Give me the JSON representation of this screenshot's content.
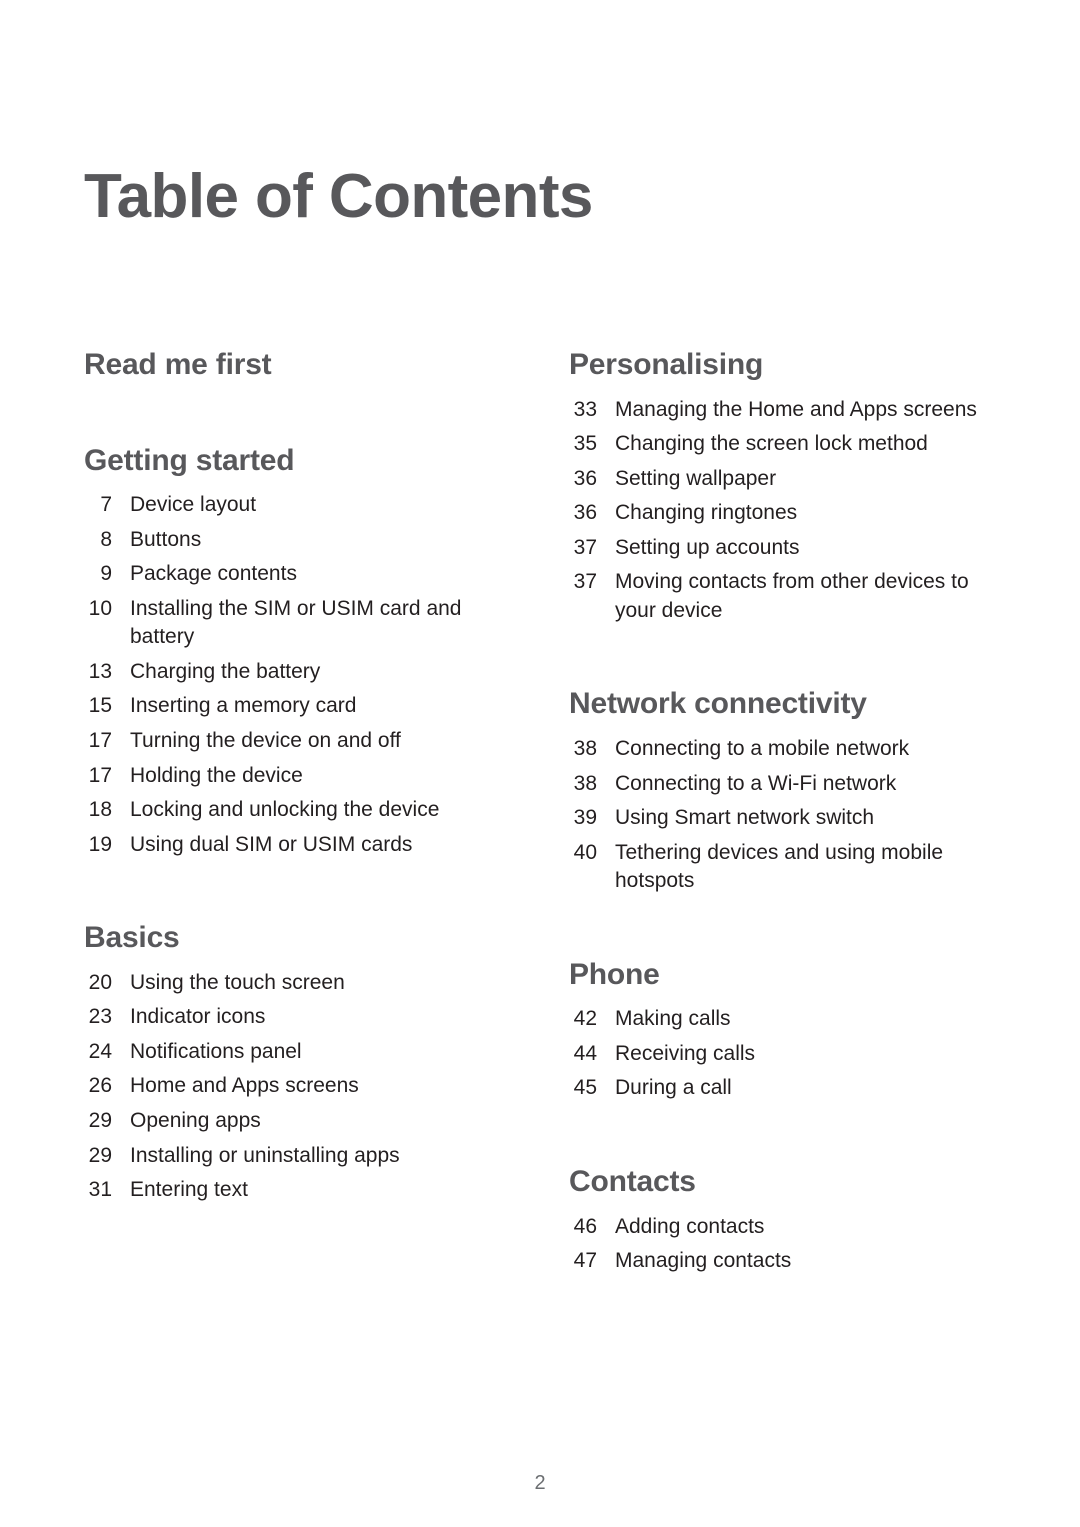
{
  "document": {
    "title": "Table of Contents",
    "folio": "2",
    "colors": {
      "heading": "#58585b",
      "body": "#231f20",
      "folio": "#6b6e71",
      "background": "#ffffff"
    }
  },
  "columns": [
    {
      "name": "left-column",
      "sections": [
        {
          "heading": "Read me first",
          "entries": []
        },
        {
          "heading": "Getting started",
          "entries": [
            {
              "page": "7",
              "title": "Device layout"
            },
            {
              "page": "8",
              "title": "Buttons"
            },
            {
              "page": "9",
              "title": "Package contents"
            },
            {
              "page": "10",
              "title": "Installing the SIM or USIM card and battery"
            },
            {
              "page": "13",
              "title": "Charging the battery"
            },
            {
              "page": "15",
              "title": "Inserting a memory card"
            },
            {
              "page": "17",
              "title": "Turning the device on and off"
            },
            {
              "page": "17",
              "title": "Holding the device"
            },
            {
              "page": "18",
              "title": "Locking and unlocking the device"
            },
            {
              "page": "19",
              "title": "Using dual SIM or USIM cards"
            }
          ]
        },
        {
          "heading": "Basics",
          "entries": [
            {
              "page": "20",
              "title": "Using the touch screen"
            },
            {
              "page": "23",
              "title": "Indicator icons"
            },
            {
              "page": "24",
              "title": "Notifications panel"
            },
            {
              "page": "26",
              "title": "Home and Apps screens"
            },
            {
              "page": "29",
              "title": "Opening apps"
            },
            {
              "page": "29",
              "title": "Installing or uninstalling apps"
            },
            {
              "page": "31",
              "title": "Entering text"
            }
          ]
        }
      ]
    },
    {
      "name": "right-column",
      "sections": [
        {
          "heading": "Personalising",
          "entries": [
            {
              "page": "33",
              "title": "Managing the Home and Apps screens"
            },
            {
              "page": "35",
              "title": "Changing the screen lock method"
            },
            {
              "page": "36",
              "title": "Setting wallpaper"
            },
            {
              "page": "36",
              "title": "Changing ringtones"
            },
            {
              "page": "37",
              "title": "Setting up accounts"
            },
            {
              "page": "37",
              "title": "Moving contacts from other devices to your device"
            }
          ]
        },
        {
          "heading": "Network connectivity",
          "entries": [
            {
              "page": "38",
              "title": "Connecting to a mobile network"
            },
            {
              "page": "38",
              "title": "Connecting to a Wi-Fi network"
            },
            {
              "page": "39",
              "title": "Using Smart network switch"
            },
            {
              "page": "40",
              "title": "Tethering devices and using mobile hotspots"
            }
          ]
        },
        {
          "heading": "Phone",
          "entries": [
            {
              "page": "42",
              "title": "Making calls"
            },
            {
              "page": "44",
              "title": "Receiving calls"
            },
            {
              "page": "45",
              "title": "During a call"
            }
          ]
        },
        {
          "heading": "Contacts",
          "entries": [
            {
              "page": "46",
              "title": "Adding contacts"
            },
            {
              "page": "47",
              "title": "Managing contacts"
            }
          ]
        }
      ]
    }
  ]
}
